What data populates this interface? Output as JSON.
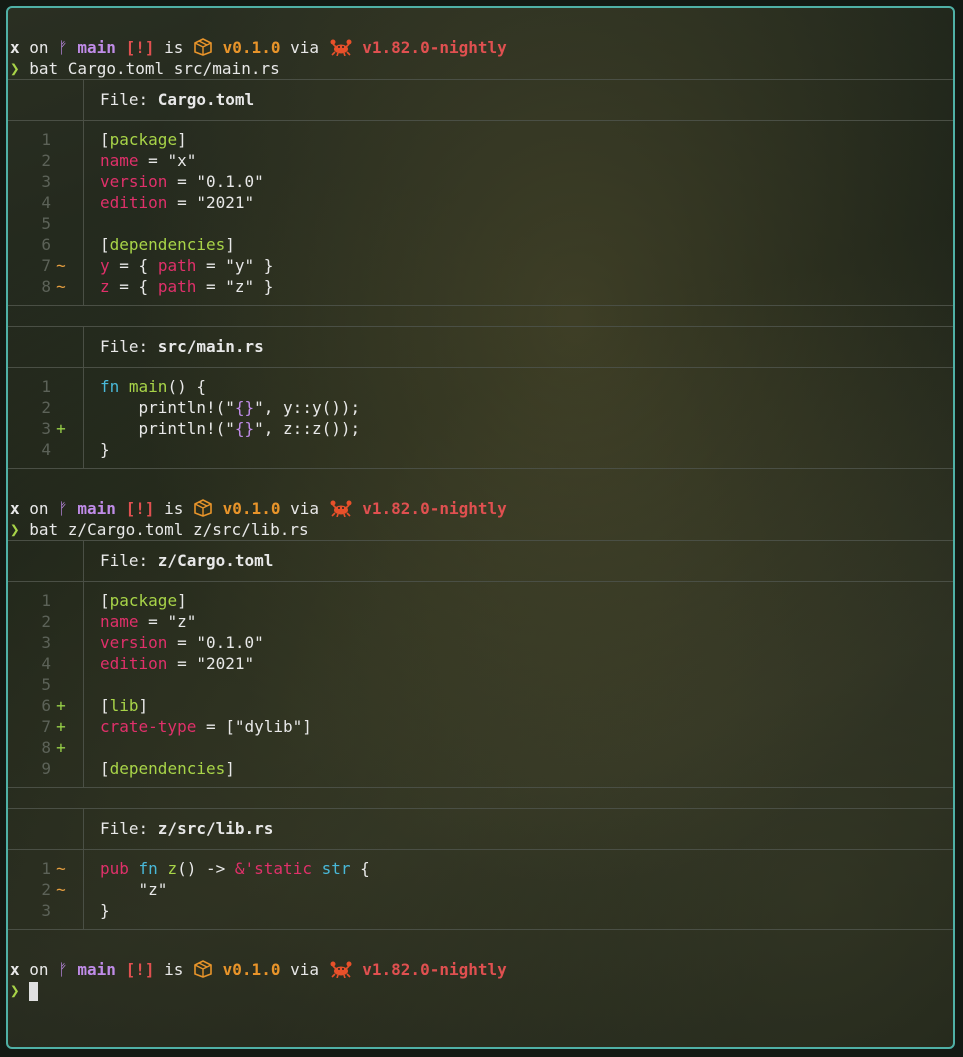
{
  "prompt": {
    "dir": "x",
    "on": " on ",
    "branch_glyph": "ᚠ",
    "branch": "main",
    "status": "[!]",
    "is": " is ",
    "version": "v0.1.0",
    "via": " via ",
    "rust": "v1.82.0-nightly",
    "caret": "❯"
  },
  "commands": [
    "bat Cargo.toml src/main.rs",
    "bat z/Cargo.toml z/src/lib.rs"
  ],
  "file_label": "File: ",
  "files": [
    {
      "name": "Cargo.toml",
      "lines": [
        {
          "n": "1",
          "m": "",
          "segs": [
            [
              "[",
              "c-white"
            ],
            [
              "package",
              "c-green"
            ],
            [
              "]",
              "c-white"
            ]
          ]
        },
        {
          "n": "2",
          "m": "",
          "segs": [
            [
              "name",
              "c-pink"
            ],
            [
              " = ",
              "c-white"
            ],
            [
              "\"x\"",
              "c-str"
            ]
          ]
        },
        {
          "n": "3",
          "m": "",
          "segs": [
            [
              "version",
              "c-pink"
            ],
            [
              " = ",
              "c-white"
            ],
            [
              "\"0.1.0\"",
              "c-str"
            ]
          ]
        },
        {
          "n": "4",
          "m": "",
          "segs": [
            [
              "edition",
              "c-pink"
            ],
            [
              " = ",
              "c-white"
            ],
            [
              "\"2021\"",
              "c-str"
            ]
          ]
        },
        {
          "n": "5",
          "m": "",
          "segs": []
        },
        {
          "n": "6",
          "m": "",
          "segs": [
            [
              "[",
              "c-white"
            ],
            [
              "dependencies",
              "c-green"
            ],
            [
              "]",
              "c-white"
            ]
          ]
        },
        {
          "n": "7",
          "m": "~",
          "segs": [
            [
              "y",
              "c-pink"
            ],
            [
              " = { ",
              "c-white"
            ],
            [
              "path",
              "c-pink"
            ],
            [
              " = ",
              "c-white"
            ],
            [
              "\"y\"",
              "c-str"
            ],
            [
              " }",
              "c-white"
            ]
          ]
        },
        {
          "n": "8",
          "m": "~",
          "segs": [
            [
              "z",
              "c-pink"
            ],
            [
              " = { ",
              "c-white"
            ],
            [
              "path",
              "c-pink"
            ],
            [
              " = ",
              "c-white"
            ],
            [
              "\"z\"",
              "c-str"
            ],
            [
              " }",
              "c-white"
            ]
          ]
        }
      ]
    },
    {
      "name": "src/main.rs",
      "lines": [
        {
          "n": "1",
          "m": "",
          "segs": [
            [
              "fn",
              "c-cyan"
            ],
            [
              " ",
              "c-white"
            ],
            [
              "main",
              "c-green"
            ],
            [
              "() {",
              "c-white"
            ]
          ]
        },
        {
          "n": "2",
          "m": "",
          "segs": [
            [
              "    println!(",
              "c-white"
            ],
            [
              "\"",
              "c-str"
            ],
            [
              "{}",
              "c-purple"
            ],
            [
              "\"",
              "c-str"
            ],
            [
              ", y::y());",
              "c-white"
            ]
          ]
        },
        {
          "n": "3",
          "m": "+",
          "segs": [
            [
              "    println!(",
              "c-white"
            ],
            [
              "\"",
              "c-str"
            ],
            [
              "{}",
              "c-purple"
            ],
            [
              "\"",
              "c-str"
            ],
            [
              ", z::z());",
              "c-white"
            ]
          ]
        },
        {
          "n": "4",
          "m": "",
          "segs": [
            [
              "}",
              "c-white"
            ]
          ]
        }
      ]
    },
    {
      "name": "z/Cargo.toml",
      "lines": [
        {
          "n": "1",
          "m": "",
          "segs": [
            [
              "[",
              "c-white"
            ],
            [
              "package",
              "c-green"
            ],
            [
              "]",
              "c-white"
            ]
          ]
        },
        {
          "n": "2",
          "m": "",
          "segs": [
            [
              "name",
              "c-pink"
            ],
            [
              " = ",
              "c-white"
            ],
            [
              "\"z\"",
              "c-str"
            ]
          ]
        },
        {
          "n": "3",
          "m": "",
          "segs": [
            [
              "version",
              "c-pink"
            ],
            [
              " = ",
              "c-white"
            ],
            [
              "\"0.1.0\"",
              "c-str"
            ]
          ]
        },
        {
          "n": "4",
          "m": "",
          "segs": [
            [
              "edition",
              "c-pink"
            ],
            [
              " = ",
              "c-white"
            ],
            [
              "\"2021\"",
              "c-str"
            ]
          ]
        },
        {
          "n": "5",
          "m": "",
          "segs": []
        },
        {
          "n": "6",
          "m": "+",
          "segs": [
            [
              "[",
              "c-white"
            ],
            [
              "lib",
              "c-green"
            ],
            [
              "]",
              "c-white"
            ]
          ]
        },
        {
          "n": "7",
          "m": "+",
          "segs": [
            [
              "crate-type",
              "c-pink"
            ],
            [
              " = [",
              "c-white"
            ],
            [
              "\"dylib\"",
              "c-str"
            ],
            [
              "]",
              "c-white"
            ]
          ]
        },
        {
          "n": "8",
          "m": "+",
          "segs": []
        },
        {
          "n": "9",
          "m": "",
          "segs": [
            [
              "[",
              "c-white"
            ],
            [
              "dependencies",
              "c-green"
            ],
            [
              "]",
              "c-white"
            ]
          ]
        }
      ]
    },
    {
      "name": "z/src/lib.rs",
      "lines": [
        {
          "n": "1",
          "m": "~",
          "segs": [
            [
              "pub",
              "c-pink"
            ],
            [
              " ",
              "c-white"
            ],
            [
              "fn",
              "c-cyan"
            ],
            [
              " ",
              "c-white"
            ],
            [
              "z",
              "c-green"
            ],
            [
              "() -> ",
              "c-white"
            ],
            [
              "&'static",
              "c-pink"
            ],
            [
              " ",
              "c-white"
            ],
            [
              "str",
              "c-cyan"
            ],
            [
              " {",
              "c-white"
            ]
          ]
        },
        {
          "n": "2",
          "m": "~",
          "segs": [
            [
              "    \"z\"",
              "c-str"
            ]
          ]
        },
        {
          "n": "3",
          "m": "",
          "segs": [
            [
              "}",
              "c-white"
            ]
          ]
        }
      ]
    }
  ],
  "colors": {
    "border": "#4fb0a6",
    "modified": "#e8a040",
    "added": "#98d048"
  }
}
